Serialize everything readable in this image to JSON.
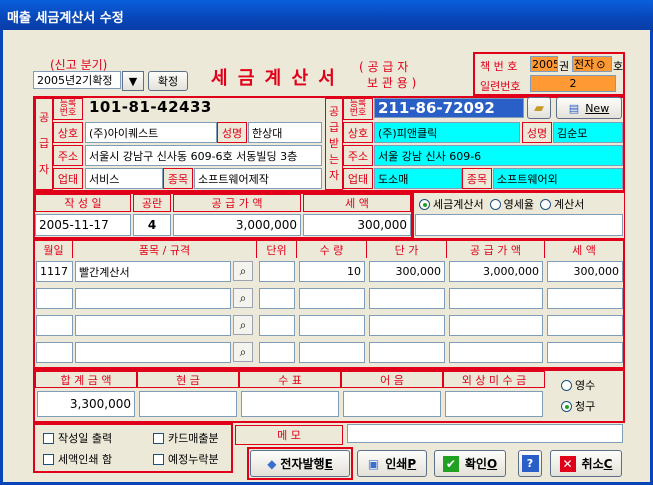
{
  "window": {
    "title": "매출 세금계산서 수정"
  },
  "period": {
    "caption": "(신고 분기)",
    "value": "2005년2기확정",
    "confirm_label": "확정"
  },
  "heading": {
    "title": "세 금 계 산 서",
    "sub_top": "( 공 급 자",
    "sub_bottom": "보 관 용 )"
  },
  "book": {
    "label_book": "책 번 호",
    "book_no": "2005",
    "unit_gwon": "권",
    "type_value": "전자",
    "unit_ho": "호",
    "label_serial": "일련번호",
    "serial_no": "2"
  },
  "supplier": {
    "side_label": [
      "공",
      "급",
      "자"
    ],
    "reg_label": "등록\n번호",
    "reg_no": "101-81-42433",
    "name_label": "상호",
    "name": "(주)아이퀘스트",
    "rep_label": "성명",
    "rep": "한상대",
    "addr_label": "주소",
    "addr": "서울시 강남구 신사동 609-6호 서동빌딩 3층",
    "biz_label": "업태",
    "biz": "서비스",
    "item_label": "종목",
    "item": "소프트웨어제작"
  },
  "buyer": {
    "side_label": [
      "공",
      "급",
      "받",
      "는",
      "자"
    ],
    "reg_label": "등록\n번호",
    "reg_no": "211-86-72092",
    "new_label": "New",
    "name_label": "상호",
    "name": "(주)피앤클릭",
    "rep_label": "성명",
    "rep": "김순모",
    "addr_label": "주소",
    "addr": "서울 강남 신사 609-6",
    "biz_label": "업태",
    "biz": "도소매",
    "item_label": "종목",
    "item": "소프트웨어외"
  },
  "summary": {
    "date_label": "작 성 일",
    "date": "2005-11-17",
    "blank_label": "공란",
    "blank": "4",
    "supply_label": "공 급 가 액",
    "supply": "3,000,000",
    "tax_label": "세 액",
    "tax": "300,000",
    "types": [
      {
        "label": "세금계산서",
        "selected": true
      },
      {
        "label": "영세율",
        "selected": false
      },
      {
        "label": "계산서",
        "selected": false
      }
    ]
  },
  "items": {
    "headers": [
      "월일",
      "품목 / 규격",
      "단위",
      "수 량",
      "단 가",
      "공 급 가 액",
      "세 액"
    ],
    "rows": [
      {
        "date": "1117",
        "name": "빨간계산서",
        "unit": "",
        "qty": "10",
        "price": "300,000",
        "supply": "3,000,000",
        "tax": "300,000"
      },
      {
        "date": "",
        "name": "",
        "unit": "",
        "qty": "",
        "price": "",
        "supply": "",
        "tax": ""
      },
      {
        "date": "",
        "name": "",
        "unit": "",
        "qty": "",
        "price": "",
        "supply": "",
        "tax": ""
      },
      {
        "date": "",
        "name": "",
        "unit": "",
        "qty": "",
        "price": "",
        "supply": "",
        "tax": ""
      }
    ]
  },
  "totals": {
    "headers": [
      "합 계 금 액",
      "현 금",
      "수 표",
      "어 음",
      "외 상 미 수 금"
    ],
    "values": [
      "3,300,000",
      "",
      "",
      "",
      ""
    ],
    "receipt_options": [
      {
        "label": "영수",
        "selected": false
      },
      {
        "label": "청구",
        "selected": true
      }
    ]
  },
  "options": {
    "print_date": "작성일 출력",
    "card_sales": "카드매출분",
    "tax_print": "세액인쇄 함",
    "planned_missing": "예정누락분",
    "memo_label": "메 모",
    "memo": ""
  },
  "buttons": {
    "e_issue": "전자발행",
    "e_issue_key": "E",
    "print": "인쇄",
    "print_key": "P",
    "ok": "확인",
    "ok_key": "O",
    "help": "?",
    "cancel": "취소",
    "cancel_key": "C"
  },
  "colors": {
    "accent_red": "#e0001a",
    "highlight_cyan": "#00ffff",
    "highlight_orange": "#ff9933",
    "title_blue": "#0846b8"
  }
}
